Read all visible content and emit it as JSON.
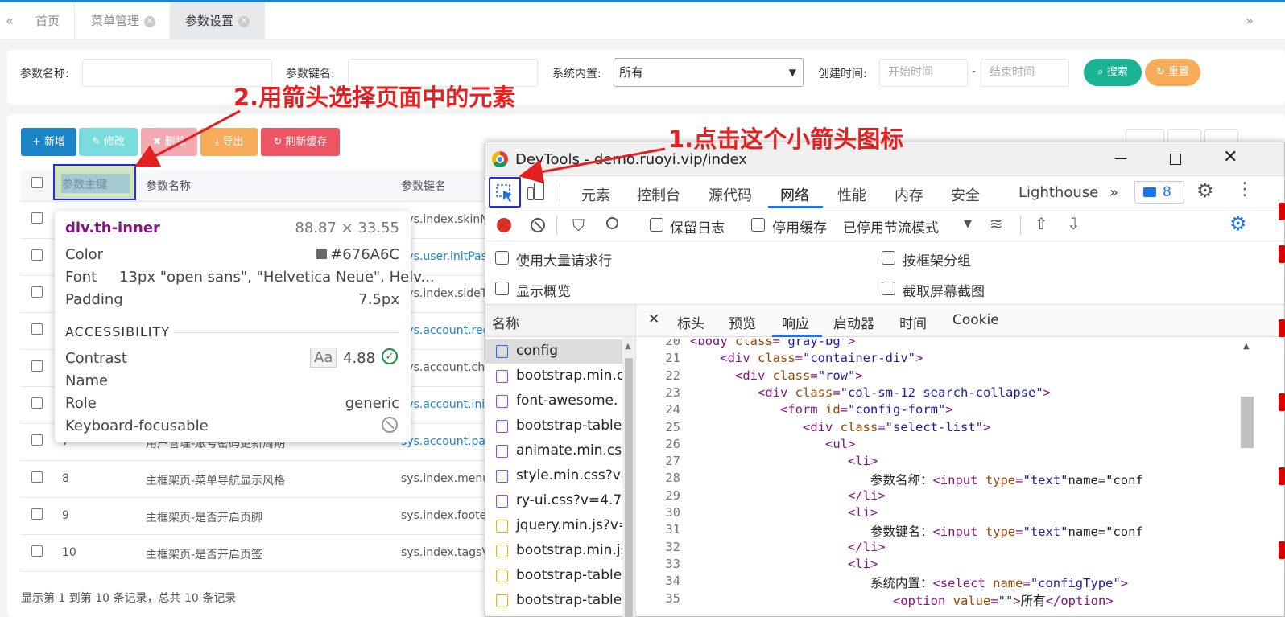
{
  "nav": {
    "prev_icon": "«",
    "next_icon": "»",
    "tabs": [
      {
        "label": "首页"
      },
      {
        "label": "菜单管理",
        "close": "✕"
      },
      {
        "label": "参数设置",
        "close": "✕"
      }
    ]
  },
  "search": {
    "name_label": "参数名称:",
    "key_label": "参数键名:",
    "type_label": "系统内置:",
    "type_value": "所有",
    "time_label": "创建时间:",
    "start_placeholder": "开始时间",
    "end_placeholder": "结束时间",
    "dash": "-",
    "search_btn": "搜索",
    "reset_btn": "重置"
  },
  "toolbar": {
    "add": "新增",
    "edit": "修改",
    "delete": "删除",
    "export": "导出",
    "refresh": "刷新缓存"
  },
  "table": {
    "headers": [
      "参数主键",
      "参数名称",
      "参数键名"
    ],
    "rows": [
      {
        "id": "",
        "name": "",
        "key": "sys.index.skinN",
        "link": false
      },
      {
        "id": "",
        "name": "",
        "key": "sys.user.initPas",
        "link": true
      },
      {
        "id": "",
        "name": "",
        "key": "sys.index.sideT",
        "link": false
      },
      {
        "id": "",
        "name": "",
        "key": "sys.account.reg",
        "link": true
      },
      {
        "id": "",
        "name": "",
        "key": "sys.account.chc",
        "link": false
      },
      {
        "id": "",
        "name": "",
        "key": "sys.account.init",
        "link": true
      },
      {
        "id": "7",
        "name": "用户管理-账号密码更新周期",
        "key": "sys.account.pa",
        "link": true
      },
      {
        "id": "8",
        "name": "主框架页-菜单导航显示风格",
        "key": "sys.index.menu",
        "link": false
      },
      {
        "id": "9",
        "name": "主框架页-是否开启页脚",
        "key": "sys.index.foote",
        "link": false
      },
      {
        "id": "10",
        "name": "主框架页-是否开启页签",
        "key": "sys.index.tagsV",
        "link": false
      }
    ],
    "footer": "显示第 1 到第 10 条记录，总共 10 条记录"
  },
  "tooltip": {
    "selector": "div.th-inner",
    "size": "88.87 × 33.55",
    "color_label": "Color",
    "color_value": "#676A6C",
    "font_label": "Font",
    "font_value": "13px \"open sans\", \"Helvetica Neue\", Helv...",
    "padding_label": "Padding",
    "padding_value": "7.5px",
    "accessibility": "ACCESSIBILITY",
    "contrast_label": "Contrast",
    "contrast_aa": "Aa",
    "contrast_value": "4.88",
    "name_label": "Name",
    "role_label": "Role",
    "role_value": "generic",
    "kbd_label": "Keyboard-focusable"
  },
  "devtools": {
    "title": "DevTools - demo.ruoyi.vip/index",
    "tabs": [
      "元素",
      "控制台",
      "源代码",
      "网络",
      "性能",
      "内存",
      "安全",
      "Lighthouse"
    ],
    "more": "»",
    "msg_count": "8",
    "preserve_log": "保留日志",
    "disable_cache": "停用缓存",
    "throttle": "已停用节流模式",
    "big_rows": "使用大量请求行",
    "group_frame": "按框架分组",
    "overview": "显示概览",
    "screenshot": "截取屏幕截图",
    "name_col": "名称",
    "files": [
      {
        "name": "config",
        "type": "doc"
      },
      {
        "name": "bootstrap.min.c",
        "type": "css"
      },
      {
        "name": "font-awesome.",
        "type": "css"
      },
      {
        "name": "bootstrap-table",
        "type": "css"
      },
      {
        "name": "animate.min.css",
        "type": "css"
      },
      {
        "name": "style.min.css?v=",
        "type": "css"
      },
      {
        "name": "ry-ui.css?v=4.7.3",
        "type": "css"
      },
      {
        "name": "jquery.min.js?v=",
        "type": "js"
      },
      {
        "name": "bootstrap.min.js",
        "type": "js"
      },
      {
        "name": "bootstrap-table",
        "type": "js"
      },
      {
        "name": "bootstrap-table",
        "type": "js"
      }
    ],
    "detail_close": "✕",
    "detail_tabs": [
      "标头",
      "预览",
      "响应",
      "启动器",
      "时间",
      "Cookie"
    ],
    "code": [
      {
        "n": "20",
        "t": "<body class=\"gray-bg\">"
      },
      {
        "n": "21",
        "t": "    <div class=\"container-div\">"
      },
      {
        "n": "22",
        "t": "      <div class=\"row\">"
      },
      {
        "n": "23",
        "t": "         <div class=\"col-sm-12 search-collapse\">"
      },
      {
        "n": "24",
        "t": "            <form id=\"config-form\">"
      },
      {
        "n": "25",
        "t": "               <div class=\"select-list\">"
      },
      {
        "n": "26",
        "t": "                  <ul>"
      },
      {
        "n": "27",
        "t": "                     <li>"
      },
      {
        "n": "28",
        "t": "                        参数名称：<input type=\"text\" name=\"conf"
      },
      {
        "n": "29",
        "t": "                     </li>"
      },
      {
        "n": "30",
        "t": "                     <li>"
      },
      {
        "n": "31",
        "t": "                        参数键名：<input type=\"text\" name=\"conf"
      },
      {
        "n": "32",
        "t": "                     </li>"
      },
      {
        "n": "33",
        "t": "                     <li>"
      },
      {
        "n": "34",
        "t": "                        系统内置：<select name=\"configType\">"
      },
      {
        "n": "35",
        "t": "                           <option value=\"\">所有</option>"
      }
    ]
  },
  "annotations": {
    "step1": "1.点击这个小箭头图标",
    "step2": "2.用箭头选择页面中的元素"
  },
  "colors": {
    "primary": "#1c84c6",
    "success": "#1ab394",
    "warning": "#f8ac59",
    "danger": "#ed5565",
    "info": "#23c6c8",
    "highlight": "#1f2ee0",
    "annotation": "#e52020"
  }
}
